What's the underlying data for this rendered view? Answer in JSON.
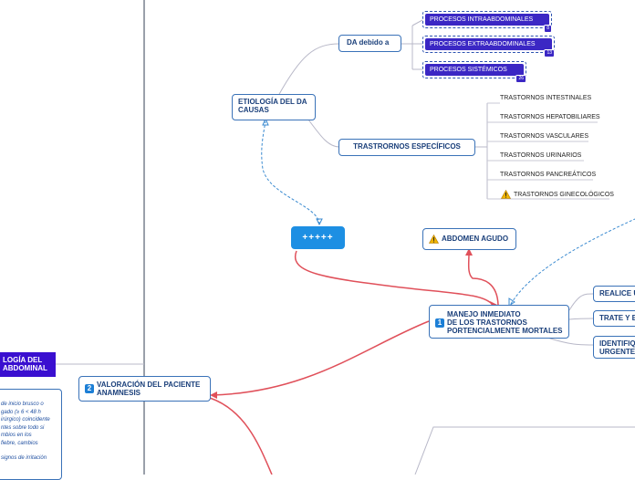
{
  "nodes": {
    "etiologia": "ETIOLOGÍA DEL DA\nCAUSAS",
    "da_debido": "DA  debido a",
    "trastornos_especificos": "TRASTRORNOS ESPECÍFICOS",
    "plus": "+++++",
    "abdomen_agudo": "ABDOMEN AGUDO",
    "manejo": "MANEJO INMEDIATO\nDE LOS TRASTORNOS\nPORTENCIALMENTE MORTALES",
    "manejo_num": "1",
    "valoracion": "VALORACIÓN DEL PACIENTE\nANAMNESIS",
    "valoracion_num": "2",
    "fisiologia": "LOGÍA DEL\n ABDOMINAL",
    "realice": "REALICE UN",
    "trate": "TRATE Y ES",
    "identifique": "IDENTIFIQU\nURGENTE"
  },
  "chips": [
    {
      "label": "PROCESOS INTRAABDOMINALES",
      "badge": "8"
    },
    {
      "label": "PROCESOS EXTRAABDOMINALES",
      "badge": "13"
    },
    {
      "label": "PROCESOS SISTÉMICOS",
      "badge": "26"
    }
  ],
  "leaves": [
    "TRASTORNOS INTESTINALES",
    "TRASTORNOS HEPATOBILIARES",
    "TRASTORNOS VASCULARES",
    "TRASTORNOS URINARIOS",
    "TRASTORNOS PANCREÁTICOS",
    "TRASTORNOS GINECOLÓGICOS"
  ],
  "note_lines": [
    "de inicio brusco o",
    "gado (≥ 6  < 48 h",
    "irúrgico) coincidente",
    "ntes sobre todo si",
    "mbios en los",
    "fiebre, cambios",
    "",
    "signos de irritación"
  ],
  "icons": {
    "warning": "warning-triangle-icon",
    "number_badge": "numbered-square-icon"
  },
  "colors": {
    "node_border": "#3a72b8",
    "node_text": "#1a3f7a",
    "accent_blue": "#1d8fe3",
    "chip_purple": "#3b27c4",
    "link_red": "#e0505a",
    "link_gray": "#b8b8c8",
    "link_dashed": "#3a8ad0"
  }
}
